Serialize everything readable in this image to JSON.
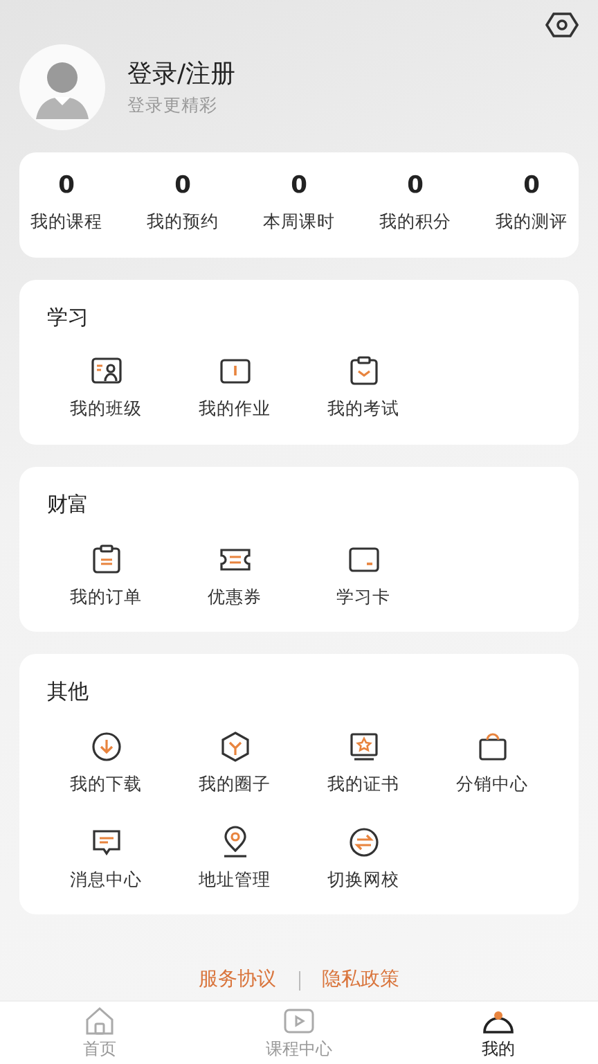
{
  "profile": {
    "name": "登录/注册",
    "subtitle": "登录更精彩"
  },
  "stats": [
    {
      "value": "0",
      "label": "我的课程"
    },
    {
      "value": "0",
      "label": "我的预约"
    },
    {
      "value": "0",
      "label": "本周课时"
    },
    {
      "value": "0",
      "label": "我的积分"
    },
    {
      "value": "0",
      "label": "我的测评"
    }
  ],
  "sections": [
    {
      "title": "学习",
      "items": [
        "我的班级",
        "我的作业",
        "我的考试"
      ]
    },
    {
      "title": "财富",
      "items": [
        "我的订单",
        "优惠券",
        "学习卡"
      ]
    },
    {
      "title": "其他",
      "items": [
        "我的下载",
        "我的圈子",
        "我的证书",
        "分销中心",
        "消息中心",
        "地址管理",
        "切换网校"
      ]
    }
  ],
  "footer_links": [
    "服务协议",
    "隐私政策"
  ],
  "tabs": [
    {
      "label": "首页",
      "selected": false
    },
    {
      "label": "课程中心",
      "selected": false
    },
    {
      "label": "我的",
      "selected": true
    }
  ]
}
